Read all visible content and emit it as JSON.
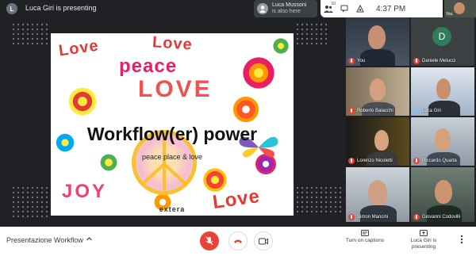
{
  "topbar": {
    "presenter_initial": "L",
    "presenting_text": "Luca Giri is presenting",
    "also_here": {
      "name": "Luca Mussoni",
      "sub": "is also here"
    },
    "participant_count": "10",
    "clock": "4:37 PM",
    "self_label": "You"
  },
  "slide": {
    "word_love_1": "Love",
    "word_love_2": "Love",
    "word_peace": "peace",
    "word_love_3": "LOVE",
    "title": "Workflow(er) power",
    "subtitle": "peace place & love",
    "word_joy": "JOY",
    "word_love_4": "Love",
    "logo": "extera"
  },
  "participants": [
    {
      "name": "You",
      "mic": "muted"
    },
    {
      "name": "Daniele Melucci",
      "initial": "D",
      "mic": "muted"
    },
    {
      "name": "Roberto Balacchi",
      "mic": "muted"
    },
    {
      "name": "Luca Giri",
      "mic": "speaking"
    },
    {
      "name": "Lorenzo Nicoletti",
      "mic": "muted"
    },
    {
      "name": "Riccardo Quarta",
      "mic": "muted"
    },
    {
      "name": "Simon Mancini",
      "mic": "muted"
    },
    {
      "name": "Giovanni Codovilli",
      "mic": "muted"
    }
  ],
  "bottombar": {
    "meeting_title": "Presentazione Workflow",
    "turn_on_captions": "Turn on captions",
    "presenting_label_1": "Luca Giri is",
    "presenting_label_2": "presenting"
  },
  "colors": {
    "accent_red": "#ea4335",
    "speaking_blue": "#8ab4f8",
    "bg_dark": "#202124"
  }
}
